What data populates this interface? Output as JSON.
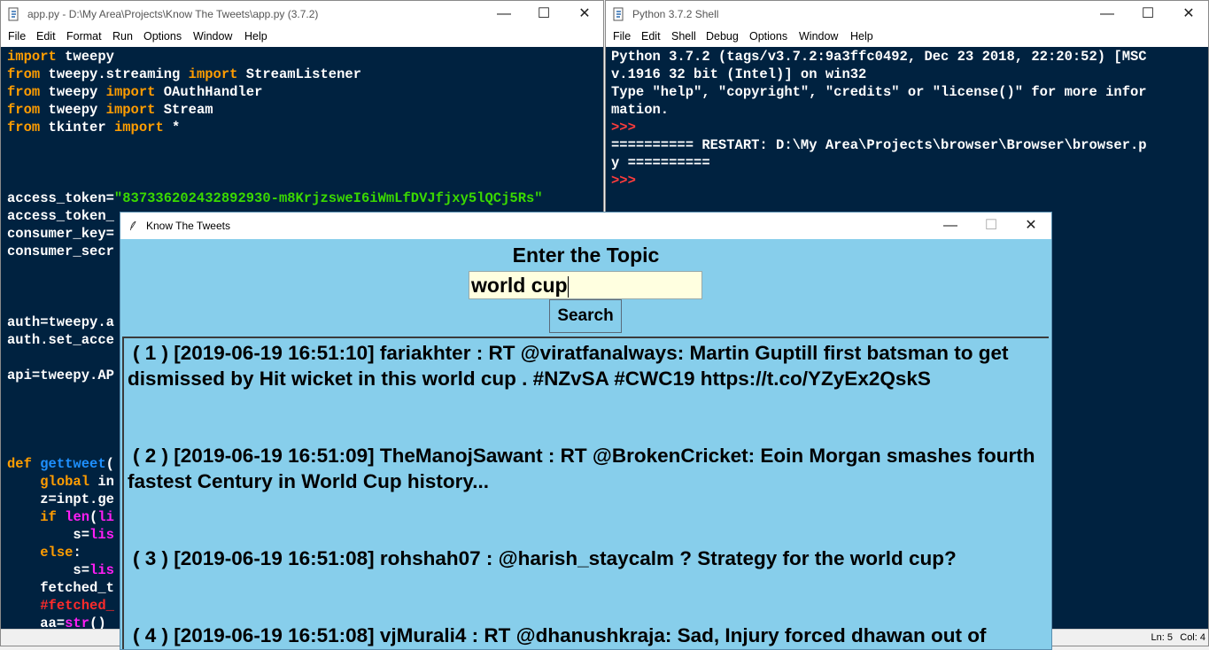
{
  "editor": {
    "title": "app.py - D:\\My Area\\Projects\\Know The Tweets\\app.py (3.7.2)",
    "menu": [
      "File",
      "Edit",
      "Format",
      "Run",
      "Options",
      "Window",
      "Help"
    ],
    "status": {
      "line": "Ln: 5",
      "col": "Col: 4"
    }
  },
  "shell": {
    "title": "Python 3.7.2 Shell",
    "menu": [
      "File",
      "Edit",
      "Shell",
      "Debug",
      "Options",
      "Window",
      "Help"
    ],
    "lines": [
      "Python 3.7.2 (tags/v3.7.2:9a3ffc0492, Dec 23 2018, 22:20:52) [MSC",
      "v.1916 32 bit (Intel)] on win32",
      "Type \"help\", \"copyright\", \"credits\" or \"license()\" for more infor",
      "mation.",
      ">>> ",
      "========== RESTART: D:\\My Area\\Projects\\browser\\Browser\\browser.p",
      "y ==========",
      ">>> "
    ]
  },
  "app": {
    "title": "Know The Tweets",
    "heading": "Enter the Topic",
    "search_value": "world cup",
    "search_button": "Search",
    "results": [
      "( 1 ) [2019-06-19 16:51:10] fariakhter : RT @viratfanalways: Martin Guptill first batsman to get dismissed by Hit wicket in this world cup . #NZvSA #CWC19 https://t.co/YZyEx2QskS",
      "( 2 ) [2019-06-19 16:51:09] TheManojSawant : RT @BrokenCricket: Eoin Morgan smashes fourth fastest Century in World Cup history...",
      "( 3 ) [2019-06-19 16:51:08] rohshah07 : @harish_staycalm ? Strategy for the world cup?",
      "( 4 ) [2019-06-19 16:51:08] vjMurali4 : RT @dhanushkraja: Sad, Injury forced dhawan out of"
    ]
  },
  "colors": {
    "editor_bg": "#002240",
    "app_bg": "#87ceeb",
    "entry_bg": "#ffffe0"
  }
}
